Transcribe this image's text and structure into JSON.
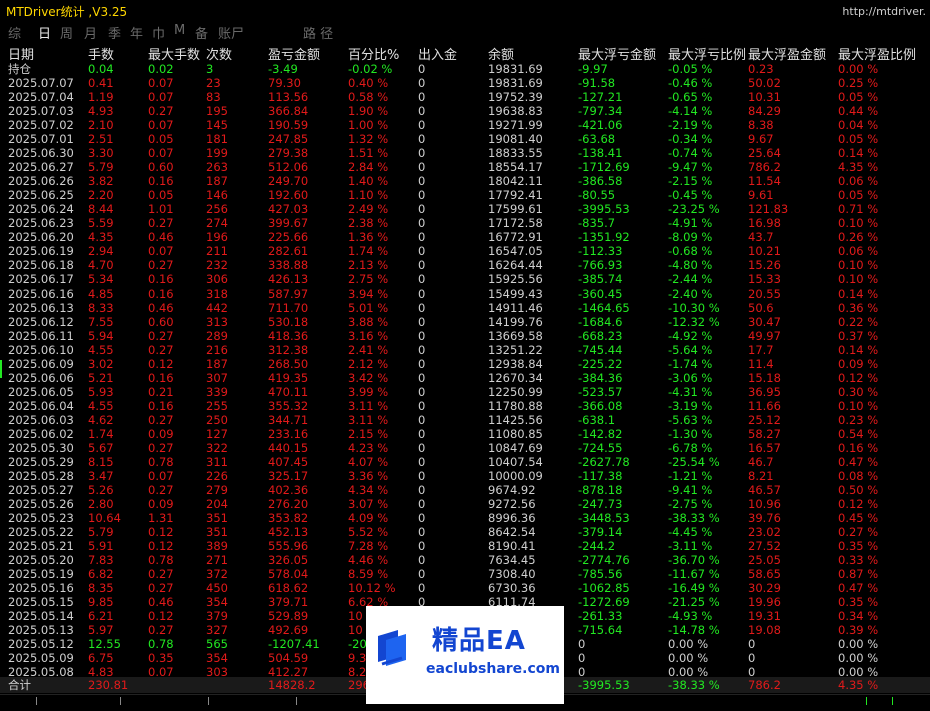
{
  "app": {
    "title": "MTDriver统计 ,V3.25",
    "url": "http://mtdriver."
  },
  "tabs": [
    "综",
    "日",
    "周",
    "月",
    "季",
    "年",
    "巾",
    "M",
    "备",
    "账尸"
  ],
  "active_tab": "日",
  "path_label": "路 径",
  "headers": [
    "日期",
    "手数",
    "最大手数",
    "次数",
    "盈亏金额",
    "百分比%",
    "出入金",
    "余额",
    "最大浮亏金额",
    "最大浮亏比例",
    "最大浮盈金额",
    "最大浮盈比例"
  ],
  "colors": {
    "positive": "#22e822",
    "negative": "#e21a1a",
    "neutral": "#d0d0d0",
    "title": "#ffd700"
  },
  "rows": [
    {
      "date": "持仓",
      "lots": "0.04",
      "maxlots": "0.02",
      "count": "3",
      "pnl": "-3.49",
      "pct": "-0.02 %",
      "io": "0",
      "bal": "19831.69",
      "fl": "-9.97",
      "flp": "-0.05 %",
      "fp": "0.23",
      "fpp": "0.00 %",
      "c": "g"
    },
    {
      "date": "2025.07.07",
      "lots": "0.41",
      "maxlots": "0.07",
      "count": "23",
      "pnl": "79.30",
      "pct": "0.40 %",
      "io": "0",
      "bal": "19831.69",
      "fl": "-91.58",
      "flp": "-0.46 %",
      "fp": "50.02",
      "fpp": "0.25 %",
      "c": "r"
    },
    {
      "date": "2025.07.04",
      "lots": "1.19",
      "maxlots": "0.07",
      "count": "83",
      "pnl": "113.56",
      "pct": "0.58 %",
      "io": "0",
      "bal": "19752.39",
      "fl": "-127.21",
      "flp": "-0.65 %",
      "fp": "10.31",
      "fpp": "0.05 %",
      "c": "r"
    },
    {
      "date": "2025.07.03",
      "lots": "4.93",
      "maxlots": "0.27",
      "count": "195",
      "pnl": "366.84",
      "pct": "1.90 %",
      "io": "0",
      "bal": "19638.83",
      "fl": "-797.34",
      "flp": "-4.14 %",
      "fp": "84.29",
      "fpp": "0.44 %",
      "c": "r"
    },
    {
      "date": "2025.07.02",
      "lots": "2.10",
      "maxlots": "0.07",
      "count": "145",
      "pnl": "190.59",
      "pct": "1.00 %",
      "io": "0",
      "bal": "19271.99",
      "fl": "-421.06",
      "flp": "-2.19 %",
      "fp": "8.38",
      "fpp": "0.04 %",
      "c": "r"
    },
    {
      "date": "2025.07.01",
      "lots": "2.51",
      "maxlots": "0.05",
      "count": "181",
      "pnl": "247.85",
      "pct": "1.32 %",
      "io": "0",
      "bal": "19081.40",
      "fl": "-63.68",
      "flp": "-0.34 %",
      "fp": "9.67",
      "fpp": "0.05 %",
      "c": "r"
    },
    {
      "date": "2025.06.30",
      "lots": "3.30",
      "maxlots": "0.07",
      "count": "199",
      "pnl": "279.38",
      "pct": "1.51 %",
      "io": "0",
      "bal": "18833.55",
      "fl": "-138.41",
      "flp": "-0.74 %",
      "fp": "25.64",
      "fpp": "0.14 %",
      "c": "r"
    },
    {
      "date": "2025.06.27",
      "lots": "5.79",
      "maxlots": "0.60",
      "count": "263",
      "pnl": "512.06",
      "pct": "2.84 %",
      "io": "0",
      "bal": "18554.17",
      "fl": "-1712.69",
      "flp": "-9.47 %",
      "fp": "786.2",
      "fpp": "4.35 %",
      "c": "r"
    },
    {
      "date": "2025.06.26",
      "lots": "3.82",
      "maxlots": "0.16",
      "count": "187",
      "pnl": "249.70",
      "pct": "1.40 %",
      "io": "0",
      "bal": "18042.11",
      "fl": "-386.58",
      "flp": "-2.15 %",
      "fp": "11.54",
      "fpp": "0.06 %",
      "c": "r"
    },
    {
      "date": "2025.06.25",
      "lots": "2.20",
      "maxlots": "0.05",
      "count": "146",
      "pnl": "192.60",
      "pct": "1.10 %",
      "io": "0",
      "bal": "17792.41",
      "fl": "-80.55",
      "flp": "-0.45 %",
      "fp": "9.61",
      "fpp": "0.05 %",
      "c": "r"
    },
    {
      "date": "2025.06.24",
      "lots": "8.44",
      "maxlots": "1.01",
      "count": "256",
      "pnl": "427.03",
      "pct": "2.49 %",
      "io": "0",
      "bal": "17599.61",
      "fl": "-3995.53",
      "flp": "-23.25 %",
      "fp": "121.83",
      "fpp": "0.71 %",
      "c": "r"
    },
    {
      "date": "2025.06.23",
      "lots": "5.59",
      "maxlots": "0.27",
      "count": "274",
      "pnl": "399.67",
      "pct": "2.38 %",
      "io": "0",
      "bal": "17172.58",
      "fl": "-835.7",
      "flp": "-4.91 %",
      "fp": "16.98",
      "fpp": "0.10 %",
      "c": "r"
    },
    {
      "date": "2025.06.20",
      "lots": "4.35",
      "maxlots": "0.46",
      "count": "196",
      "pnl": "225.66",
      "pct": "1.36 %",
      "io": "0",
      "bal": "16772.91",
      "fl": "-1351.92",
      "flp": "-8.09 %",
      "fp": "43.7",
      "fpp": "0.26 %",
      "c": "r"
    },
    {
      "date": "2025.06.19",
      "lots": "2.94",
      "maxlots": "0.07",
      "count": "211",
      "pnl": "282.61",
      "pct": "1.74 %",
      "io": "0",
      "bal": "16547.05",
      "fl": "-112.33",
      "flp": "-0.68 %",
      "fp": "10.21",
      "fpp": "0.06 %",
      "c": "r"
    },
    {
      "date": "2025.06.18",
      "lots": "4.70",
      "maxlots": "0.27",
      "count": "232",
      "pnl": "338.88",
      "pct": "2.13 %",
      "io": "0",
      "bal": "16264.44",
      "fl": "-766.93",
      "flp": "-4.80 %",
      "fp": "15.26",
      "fpp": "0.10 %",
      "c": "r"
    },
    {
      "date": "2025.06.17",
      "lots": "5.34",
      "maxlots": "0.16",
      "count": "306",
      "pnl": "426.13",
      "pct": "2.75 %",
      "io": "0",
      "bal": "15925.56",
      "fl": "-385.74",
      "flp": "-2.44 %",
      "fp": "15.33",
      "fpp": "0.10 %",
      "c": "r"
    },
    {
      "date": "2025.06.16",
      "lots": "4.85",
      "maxlots": "0.16",
      "count": "318",
      "pnl": "587.97",
      "pct": "3.94 %",
      "io": "0",
      "bal": "15499.43",
      "fl": "-360.45",
      "flp": "-2.40 %",
      "fp": "20.55",
      "fpp": "0.14 %",
      "c": "r"
    },
    {
      "date": "2025.06.13",
      "lots": "8.33",
      "maxlots": "0.46",
      "count": "442",
      "pnl": "711.70",
      "pct": "5.01 %",
      "io": "0",
      "bal": "14911.46",
      "fl": "-1464.65",
      "flp": "-10.30 %",
      "fp": "50.6",
      "fpp": "0.36 %",
      "c": "r"
    },
    {
      "date": "2025.06.12",
      "lots": "7.55",
      "maxlots": "0.60",
      "count": "313",
      "pnl": "530.18",
      "pct": "3.88 %",
      "io": "0",
      "bal": "14199.76",
      "fl": "-1684.6",
      "flp": "-12.32 %",
      "fp": "30.47",
      "fpp": "0.22 %",
      "c": "r"
    },
    {
      "date": "2025.06.11",
      "lots": "5.94",
      "maxlots": "0.27",
      "count": "289",
      "pnl": "418.36",
      "pct": "3.16 %",
      "io": "0",
      "bal": "13669.58",
      "fl": "-668.23",
      "flp": "-4.92 %",
      "fp": "49.97",
      "fpp": "0.37 %",
      "c": "r"
    },
    {
      "date": "2025.06.10",
      "lots": "4.55",
      "maxlots": "0.27",
      "count": "216",
      "pnl": "312.38",
      "pct": "2.41 %",
      "io": "0",
      "bal": "13251.22",
      "fl": "-745.44",
      "flp": "-5.64 %",
      "fp": "17.7",
      "fpp": "0.14 %",
      "c": "r"
    },
    {
      "date": "2025.06.09",
      "lots": "3.02",
      "maxlots": "0.12",
      "count": "187",
      "pnl": "268.50",
      "pct": "2.12 %",
      "io": "0",
      "bal": "12938.84",
      "fl": "-225.22",
      "flp": "-1.74 %",
      "fp": "11.4",
      "fpp": "0.09 %",
      "c": "r"
    },
    {
      "date": "2025.06.06",
      "lots": "5.21",
      "maxlots": "0.16",
      "count": "307",
      "pnl": "419.35",
      "pct": "3.42 %",
      "io": "0",
      "bal": "12670.34",
      "fl": "-384.36",
      "flp": "-3.06 %",
      "fp": "15.18",
      "fpp": "0.12 %",
      "c": "r"
    },
    {
      "date": "2025.06.05",
      "lots": "5.93",
      "maxlots": "0.21",
      "count": "339",
      "pnl": "470.11",
      "pct": "3.99 %",
      "io": "0",
      "bal": "12250.99",
      "fl": "-523.57",
      "flp": "-4.31 %",
      "fp": "36.95",
      "fpp": "0.30 %",
      "c": "r"
    },
    {
      "date": "2025.06.04",
      "lots": "4.55",
      "maxlots": "0.16",
      "count": "255",
      "pnl": "355.32",
      "pct": "3.11 %",
      "io": "0",
      "bal": "11780.88",
      "fl": "-366.08",
      "flp": "-3.19 %",
      "fp": "11.66",
      "fpp": "0.10 %",
      "c": "r"
    },
    {
      "date": "2025.06.03",
      "lots": "4.62",
      "maxlots": "0.27",
      "count": "250",
      "pnl": "344.71",
      "pct": "3.11 %",
      "io": "0",
      "bal": "11425.56",
      "fl": "-638.1",
      "flp": "-5.63 %",
      "fp": "25.12",
      "fpp": "0.23 %",
      "c": "r"
    },
    {
      "date": "2025.06.02",
      "lots": "1.74",
      "maxlots": "0.09",
      "count": "127",
      "pnl": "233.16",
      "pct": "2.15 %",
      "io": "0",
      "bal": "11080.85",
      "fl": "-142.82",
      "flp": "-1.30 %",
      "fp": "58.27",
      "fpp": "0.54 %",
      "c": "r"
    },
    {
      "date": "2025.05.30",
      "lots": "5.67",
      "maxlots": "0.27",
      "count": "322",
      "pnl": "440.15",
      "pct": "4.23 %",
      "io": "0",
      "bal": "10847.69",
      "fl": "-724.55",
      "flp": "-6.78 %",
      "fp": "16.57",
      "fpp": "0.16 %",
      "c": "r"
    },
    {
      "date": "2025.05.29",
      "lots": "8.15",
      "maxlots": "0.78",
      "count": "311",
      "pnl": "407.45",
      "pct": "4.07 %",
      "io": "0",
      "bal": "10407.54",
      "fl": "-2627.78",
      "flp": "-25.54 %",
      "fp": "46.7",
      "fpp": "0.47 %",
      "c": "r"
    },
    {
      "date": "2025.05.28",
      "lots": "3.47",
      "maxlots": "0.07",
      "count": "226",
      "pnl": "325.17",
      "pct": "3.36 %",
      "io": "0",
      "bal": "10000.09",
      "fl": "-117.38",
      "flp": "-1.21 %",
      "fp": "8.21",
      "fpp": "0.08 %",
      "c": "r"
    },
    {
      "date": "2025.05.27",
      "lots": "5.26",
      "maxlots": "0.27",
      "count": "279",
      "pnl": "402.36",
      "pct": "4.34 %",
      "io": "0",
      "bal": "9674.92",
      "fl": "-878.18",
      "flp": "-9.41 %",
      "fp": "46.57",
      "fpp": "0.50 %",
      "c": "r"
    },
    {
      "date": "2025.05.26",
      "lots": "2.80",
      "maxlots": "0.09",
      "count": "204",
      "pnl": "276.20",
      "pct": "3.07 %",
      "io": "0",
      "bal": "9272.56",
      "fl": "-247.73",
      "flp": "-2.75 %",
      "fp": "10.96",
      "fpp": "0.12 %",
      "c": "r"
    },
    {
      "date": "2025.05.23",
      "lots": "10.64",
      "maxlots": "1.31",
      "count": "351",
      "pnl": "353.82",
      "pct": "4.09 %",
      "io": "0",
      "bal": "8996.36",
      "fl": "-3448.53",
      "flp": "-38.33 %",
      "fp": "39.76",
      "fpp": "0.45 %",
      "c": "r"
    },
    {
      "date": "2025.05.22",
      "lots": "5.79",
      "maxlots": "0.12",
      "count": "351",
      "pnl": "452.13",
      "pct": "5.52 %",
      "io": "0",
      "bal": "8642.54",
      "fl": "-379.14",
      "flp": "-4.45 %",
      "fp": "23.02",
      "fpp": "0.27 %",
      "c": "r"
    },
    {
      "date": "2025.05.21",
      "lots": "5.91",
      "maxlots": "0.12",
      "count": "389",
      "pnl": "555.96",
      "pct": "7.28 %",
      "io": "0",
      "bal": "8190.41",
      "fl": "-244.2",
      "flp": "-3.11 %",
      "fp": "27.52",
      "fpp": "0.35 %",
      "c": "r"
    },
    {
      "date": "2025.05.20",
      "lots": "7.83",
      "maxlots": "0.78",
      "count": "271",
      "pnl": "326.05",
      "pct": "4.46 %",
      "io": "0",
      "bal": "7634.45",
      "fl": "-2774.76",
      "flp": "-36.70 %",
      "fp": "25.05",
      "fpp": "0.33 %",
      "c": "r"
    },
    {
      "date": "2025.05.19",
      "lots": "6.82",
      "maxlots": "0.27",
      "count": "372",
      "pnl": "578.04",
      "pct": "8.59 %",
      "io": "0",
      "bal": "7308.40",
      "fl": "-785.56",
      "flp": "-11.67 %",
      "fp": "58.65",
      "fpp": "0.87 %",
      "c": "r"
    },
    {
      "date": "2025.05.16",
      "lots": "8.35",
      "maxlots": "0.27",
      "count": "450",
      "pnl": "618.62",
      "pct": "10.12 %",
      "io": "0",
      "bal": "6730.36",
      "fl": "-1062.85",
      "flp": "-16.49 %",
      "fp": "30.29",
      "fpp": "0.47 %",
      "c": "r"
    },
    {
      "date": "2025.05.15",
      "lots": "9.85",
      "maxlots": "0.46",
      "count": "354",
      "pnl": "379.71",
      "pct": "6.62 %",
      "io": "0",
      "bal": "6111.74",
      "fl": "-1272.69",
      "flp": "-21.25 %",
      "fp": "19.96",
      "fpp": "0.35 %",
      "c": "r"
    },
    {
      "date": "2025.05.14",
      "lots": "6.21",
      "maxlots": "0.12",
      "count": "379",
      "pnl": "529.89",
      "pct": "10",
      "io": "0",
      "bal": "",
      "fl": "-261.33",
      "flp": "-4.93 %",
      "fp": "19.31",
      "fpp": "0.34 %",
      "c": "r"
    },
    {
      "date": "2025.05.13",
      "lots": "5.97",
      "maxlots": "0.27",
      "count": "327",
      "pnl": "492.69",
      "pct": "10",
      "io": "0",
      "bal": "",
      "fl": "-715.64",
      "flp": "-14.78 %",
      "fp": "19.08",
      "fpp": "0.39 %",
      "c": "r"
    },
    {
      "date": "2025.05.12",
      "lots": "12.55",
      "maxlots": "0.78",
      "count": "565",
      "pnl": "-1207.41",
      "pct": "-20",
      "io": "0",
      "bal": "",
      "fl": "0",
      "flp": "0.00 %",
      "fp": "0",
      "fpp": "0.00 %",
      "c": "g"
    },
    {
      "date": "2025.05.09",
      "lots": "6.75",
      "maxlots": "0.35",
      "count": "354",
      "pnl": "504.59",
      "pct": "9.3",
      "io": "0",
      "bal": "",
      "fl": "0",
      "flp": "0.00 %",
      "fp": "0",
      "fpp": "0.00 %",
      "c": "r"
    },
    {
      "date": "2025.05.08",
      "lots": "4.83",
      "maxlots": "0.07",
      "count": "303",
      "pnl": "412.27",
      "pct": "8.2",
      "io": "0",
      "bal": "",
      "fl": "0",
      "flp": "0.00 %",
      "fp": "0",
      "fpp": "0.00 %",
      "c": "r"
    }
  ],
  "summary": {
    "label": "合计",
    "lots": "230.81",
    "pnl": "14828.2",
    "pct": "296",
    "fl": "-3995.53",
    "flp": "-38.33 %",
    "fp": "786.2",
    "fpp": "4.35 %"
  },
  "watermark": {
    "title": "精品EA",
    "site": "eaclubshare.com"
  }
}
